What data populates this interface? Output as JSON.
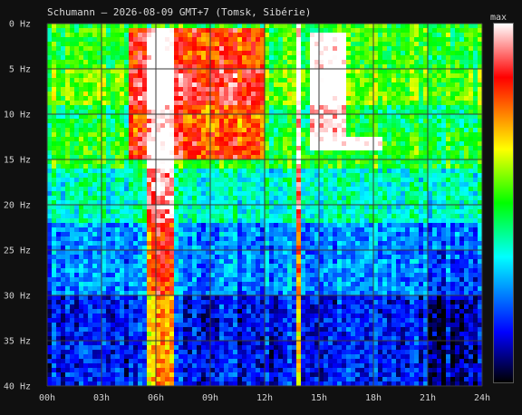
{
  "chart_data": {
    "type": "heatmap",
    "title": "Schumann — 2026-08-09 GMT+7  (Tomsk, Sibérie)",
    "x_ticks": [
      "00h",
      "03h",
      "06h",
      "09h",
      "12h",
      "15h",
      "18h",
      "21h",
      "24h"
    ],
    "y_ticks": [
      "0 Hz",
      "5 Hz",
      "10 Hz",
      "15 Hz",
      "20 Hz",
      "25 Hz",
      "30 Hz",
      "35 Hz",
      "40 Hz"
    ],
    "x_range_hours": [
      0,
      24
    ],
    "y_range_hz": [
      0,
      40
    ],
    "y_inverted": true,
    "grid": true,
    "colorbar": {
      "label": "max",
      "placement": "right",
      "colors": [
        "#000000",
        "#0000ff",
        "#00ffff",
        "#00ff00",
        "#ffff00",
        "#ff8000",
        "#ff0000",
        "#ffffff"
      ]
    },
    "background_intensity_by_band": [
      {
        "band_hz": [
          0,
          5
        ],
        "level": 0.5
      },
      {
        "band_hz": [
          5,
          9
        ],
        "level": 0.55
      },
      {
        "band_hz": [
          9,
          12
        ],
        "level": 0.45
      },
      {
        "band_hz": [
          12,
          16
        ],
        "level": 0.5
      },
      {
        "band_hz": [
          16,
          22
        ],
        "level": 0.38
      },
      {
        "band_hz": [
          22,
          30
        ],
        "level": 0.25
      },
      {
        "band_hz": [
          30,
          40
        ],
        "level": 0.15
      }
    ],
    "bright_regions": [
      {
        "hours": [
          5.5,
          6.9
        ],
        "hz": [
          0.5,
          40
        ],
        "level": "white / red"
      },
      {
        "hours": [
          4.5,
          12.0
        ],
        "hz": [
          0.5,
          15
        ],
        "level": "yellow / red"
      },
      {
        "hours": [
          13.7,
          14.1
        ],
        "hz": [
          0,
          40
        ],
        "level": "white"
      },
      {
        "hours": [
          14.5,
          16.5
        ],
        "hz": [
          1,
          14
        ],
        "level": "white / red"
      },
      {
        "hours": [
          14.5,
          18.5
        ],
        "hz": [
          12.5,
          14
        ],
        "level": "white / yellow"
      }
    ]
  }
}
